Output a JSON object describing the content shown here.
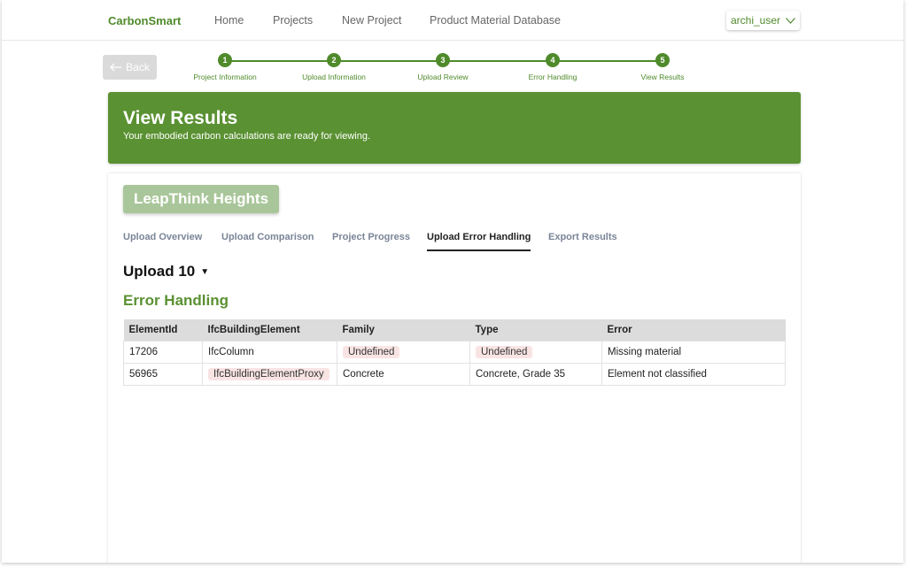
{
  "nav": {
    "brand": "CarbonSmart",
    "links": [
      "Home",
      "Projects",
      "New Project",
      "Product Material Database"
    ],
    "user": "archi_user"
  },
  "back_label": "Back",
  "stepper": [
    {
      "num": "1",
      "label": "Project Information"
    },
    {
      "num": "2",
      "label": "Upload Information"
    },
    {
      "num": "3",
      "label": "Upload Review"
    },
    {
      "num": "4",
      "label": "Error Handling"
    },
    {
      "num": "5",
      "label": "View Results"
    }
  ],
  "banner": {
    "title": "View Results",
    "subtitle": "Your embodied carbon calculations are ready for viewing."
  },
  "project_name": "LeapThink Heights",
  "tabs": [
    "Upload Overview",
    "Upload Comparison",
    "Project Progress",
    "Upload Error Handling",
    "Export Results"
  ],
  "upload_select": "Upload 10",
  "section_title": "Error Handling",
  "table": {
    "headers": [
      "ElementId",
      "IfcBuildingElement",
      "Family",
      "Type",
      "Error"
    ],
    "rows": [
      [
        "17206",
        "IfcColumn",
        "Undefined",
        "Undefined",
        "Missing material"
      ],
      [
        "56965",
        "IfcBuildingElementProxy",
        "Concrete",
        "Concrete, Grade 35",
        "Element not classified"
      ]
    ]
  },
  "colors": {
    "accent": "#5a9132",
    "brand": "#4f8a2b",
    "error_bg": "#f9e4e4"
  }
}
